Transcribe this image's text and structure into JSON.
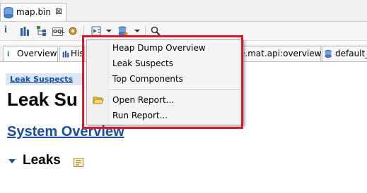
{
  "editor_tab": {
    "title": "map.bin",
    "close": "⊠"
  },
  "inner_tabs": [
    {
      "label": "Overview",
      "icon": "info-icon"
    },
    {
      "label": "His"
    },
    {
      "label": "e.mat.api:overview"
    },
    {
      "label": "default_"
    }
  ],
  "toolbar": {
    "info": "i",
    "oql": "OQL"
  },
  "content": {
    "breadcrumb": "Leak Suspects",
    "title": "Leak Su",
    "system_overview": "System Overview",
    "leaks": "Leaks"
  },
  "menu": {
    "items": [
      "Heap Dump Overview",
      "Leak Suspects",
      "Top Components",
      "Open Report...",
      "Run Report..."
    ]
  },
  "colors": {
    "highlight": "#e2142a",
    "link": "#1a4ea3",
    "accent": "#3a7bd5"
  }
}
